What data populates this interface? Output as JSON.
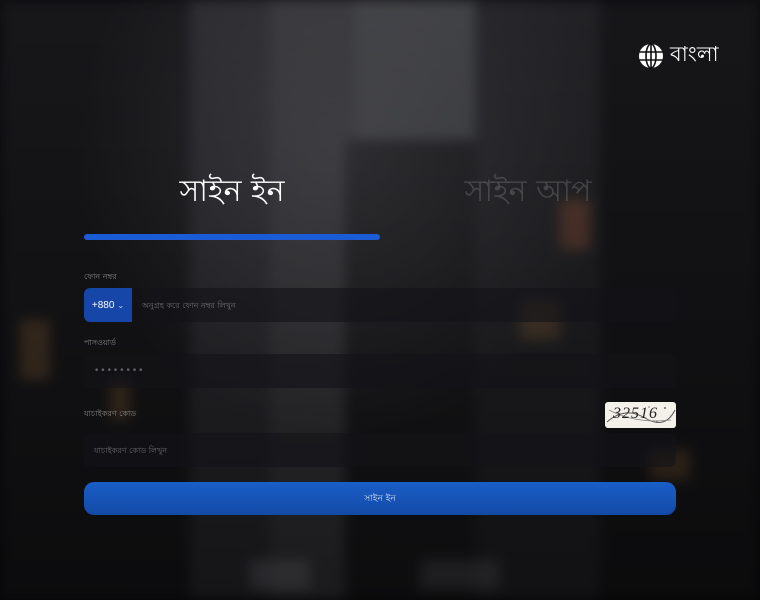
{
  "language": {
    "label": "বাংলা",
    "icon": "globe-icon"
  },
  "tabs": {
    "sign_in": "সাইন ইন",
    "sign_up": "সাইন আপ"
  },
  "form": {
    "phone": {
      "label": "ফোন নম্বর",
      "country_code": "+880",
      "placeholder": "অনুগ্রহ করে ফোন নম্বর লিখুন",
      "value": ""
    },
    "password": {
      "label": "পাসওয়ার্ড",
      "placeholder": "••••••••",
      "value": ""
    },
    "captcha": {
      "label": "যাচাইকরণ কোড",
      "placeholder": "যাচাইকরণ কোড লিখুন",
      "image_text": "32516",
      "value": ""
    },
    "submit_label": "সাইন ইন"
  },
  "colors": {
    "accent": "#1a5bd6",
    "button": "#1550b8"
  }
}
